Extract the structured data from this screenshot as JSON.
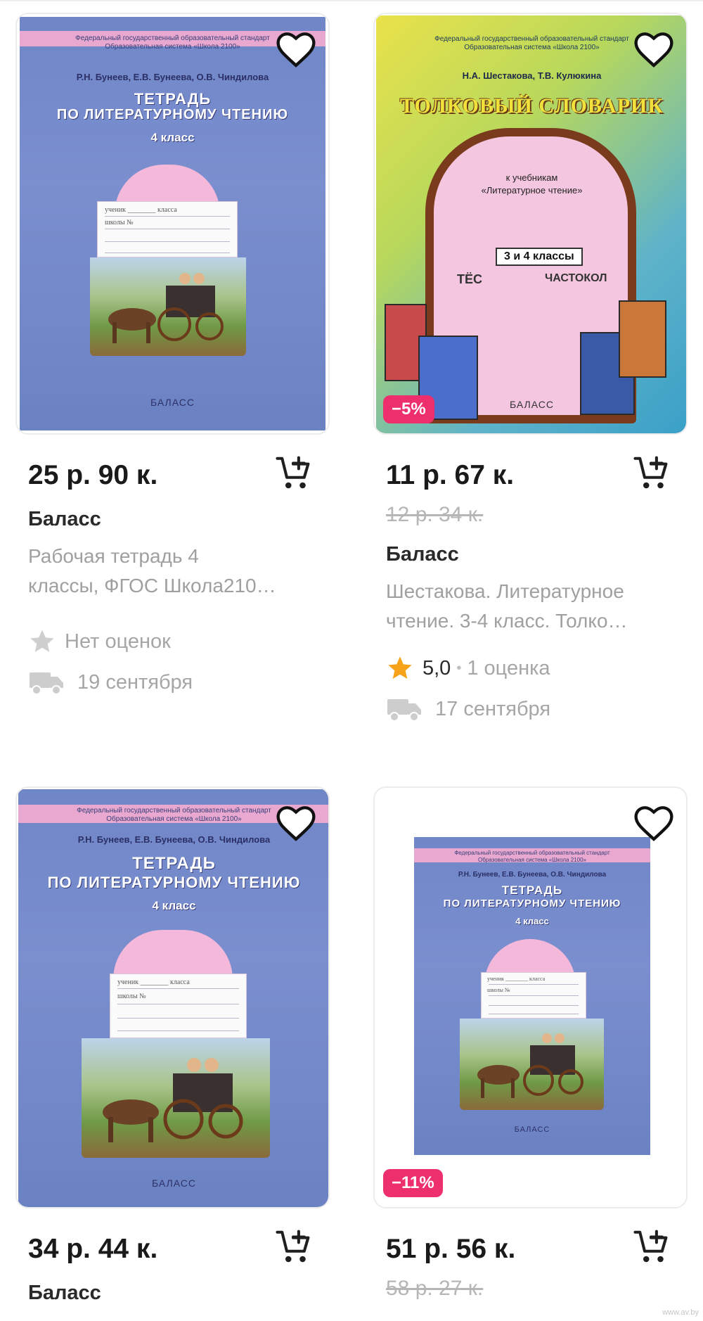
{
  "products": [
    {
      "price": "25 р. 90 к.",
      "old_price": "",
      "discount": "",
      "brand": "Баласс",
      "desc_line1": "Рабочая тетрадь 4",
      "desc_line2": "классы, ФГОС Школа210…",
      "rating_text": "Нет оценок",
      "delivery": "19 сентября",
      "cover": {
        "meta": "Федеральный государственный образовательный стандарт",
        "meta2": "Образовательная система «Школа 2100»",
        "authors": "Р.Н. Бунеев, Е.В. Бунеева, О.В. Чиндилова",
        "title1": "ТЕТРАДЬ",
        "title2": "ПО ЛИТЕРАТУРНОМУ ЧТЕНИЮ",
        "grade": "4 класс",
        "plate1": "ученик ________ класса",
        "plate2": "школы №",
        "publisher": "БАЛАСС"
      }
    },
    {
      "price": "11 р. 67 к.",
      "old_price": "12 р. 34 к.",
      "discount": "−5%",
      "brand": "Баласс",
      "desc_line1": "Шестакова. Литературное",
      "desc_line2": "чтение. 3-4 класс. Толко…",
      "rating_value": "5,0",
      "rating_dot": "•",
      "rating_count": "1 оценка",
      "delivery": "17 сентября",
      "cover": {
        "meta": "Федеральный государственный образовательный стандарт",
        "meta2": "Образовательная система «Школа 2100»",
        "authors": "Н.А. Шестакова, Т.В. Кулюкина",
        "title": "ТОЛКОВЫЙ СЛОВАРИК",
        "sub1": "к учебникам",
        "sub2": "«Литературное чтение»",
        "grade_tag": "3 и 4 классы",
        "word1": "ТЁС",
        "word2": "ЧАСТОКОЛ",
        "publisher": "БАЛАСС"
      }
    },
    {
      "price": "34 р. 44 к.",
      "old_price": "",
      "discount": "",
      "brand": "Баласс",
      "cover": {
        "meta": "Федеральный государственный образовательный стандарт",
        "meta2": "Образовательная система «Школа 2100»",
        "authors": "Р.Н. Бунеев, Е.В. Бунеева, О.В. Чиндилова",
        "title1": "ТЕТРАДЬ",
        "title2": "ПО ЛИТЕРАТУРНОМУ ЧТЕНИЮ",
        "grade": "4 класс",
        "plate1": "ученик ________ класса",
        "plate2": "школы №",
        "publisher": "БАЛАСС"
      }
    },
    {
      "price": "51 р. 56 к.",
      "old_price": "58 р. 27 к.",
      "discount": "−11%",
      "brand": "",
      "cover": {
        "meta": "Федеральный государственный образовательный стандарт",
        "meta2": "Образовательная система «Школа 2100»",
        "authors": "Р.Н. Бунеев, Е.В. Бунеева, О.В. Чиндилова",
        "title1": "ТЕТРАДЬ",
        "title2": "ПО ЛИТЕРАТУРНОМУ ЧТЕНИЮ",
        "grade": "4 класс",
        "plate1": "ученик ________ класса",
        "plate2": "школы №",
        "publisher": "БАЛАСС"
      }
    }
  ],
  "icons": {
    "favorite": "heart-outline-icon",
    "cart": "add-to-cart-icon",
    "star_empty": "star-gray-icon",
    "star_filled": "star-orange-icon",
    "delivery": "truck-icon"
  },
  "colors": {
    "discount_badge": "#ee2f6d",
    "star_filled": "#f7a21b",
    "muted_text": "#a6a6a6"
  },
  "watermark": "www.av.by"
}
